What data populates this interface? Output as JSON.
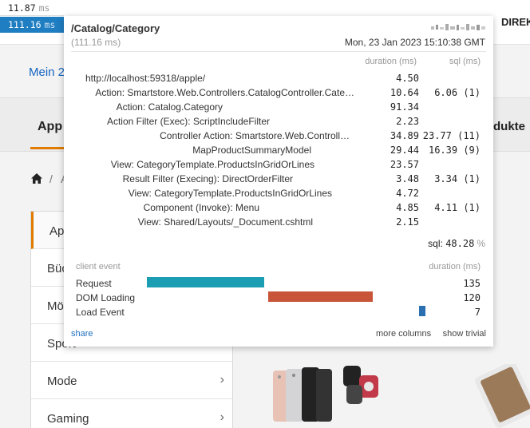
{
  "page": {
    "top_right_text": "DIREK",
    "mein_text": "Mein 2",
    "nav_active": "App",
    "nav_right": "dukte",
    "breadcrumb_sep": "/",
    "breadcrumb_partial": "A",
    "sidebar": [
      {
        "label": "App",
        "active": true
      },
      {
        "label": "Büc",
        "active": false
      },
      {
        "label": "Mö",
        "active": false
      },
      {
        "label": "Sport",
        "active": false
      },
      {
        "label": "Mode",
        "active": false
      },
      {
        "label": "Gaming",
        "active": false
      }
    ]
  },
  "profiler": {
    "pills": [
      {
        "value": "11.87",
        "unit": "ms"
      },
      {
        "value": "111.16",
        "unit": "ms"
      }
    ],
    "title": "/Catalog/Category",
    "total": "(111.16 ms)",
    "date": "Mon, 23 Jan 2023 15:10:38 GMT",
    "headers": {
      "duration": "duration (ms)",
      "sql": "sql (ms)"
    },
    "rows": [
      {
        "name": "http://localhost:59318/apple/",
        "duration": "4.50",
        "sql": ""
      },
      {
        "name": "Action: Smartstore.Web.Controllers.CatalogController.Cate…",
        "duration": "10.64",
        "sql": "6.06 (1)"
      },
      {
        "name": "Action: Catalog.Category",
        "duration": "91.34",
        "sql": ""
      },
      {
        "name": "Action Filter (Exec): ScriptIncludeFilter",
        "duration": "2.23",
        "sql": ""
      },
      {
        "name": "Controller Action: Smartstore.Web.Controll…",
        "duration": "34.89",
        "sql": "23.77 (11)"
      },
      {
        "name": "MapProductSummaryModel",
        "duration": "29.44",
        "sql": "16.39 (9)"
      },
      {
        "name": "View: CategoryTemplate.ProductsInGridOrLines",
        "duration": "23.57",
        "sql": ""
      },
      {
        "name": "Result Filter (Execing): DirectOrderFilter",
        "duration": "3.48",
        "sql": "3.34 (1)"
      },
      {
        "name": "View: CategoryTemplate.ProductsInGridOrLines",
        "duration": "4.72",
        "sql": ""
      },
      {
        "name": "Component (Invoke): Menu",
        "duration": "4.85",
        "sql": "4.11 (1)"
      },
      {
        "name": "View: Shared/Layouts/_Document.cshtml",
        "duration": "2.15",
        "sql": ""
      }
    ],
    "sql_label": "sql:",
    "sql_pct": "48.28",
    "sql_pct_unit": "%",
    "client_events": {
      "header": "client event",
      "duration_header": "duration (ms)",
      "events": [
        {
          "label": "Request",
          "duration": "135",
          "color": "#1b9db3"
        },
        {
          "label": "DOM Loading",
          "duration": "120",
          "color": "#c8553a"
        },
        {
          "label": "Load Event",
          "duration": "7",
          "color": "#2a6fb0"
        }
      ]
    },
    "links": {
      "share": "share",
      "more_columns": "more columns",
      "show_trivial": "show trivial"
    }
  }
}
